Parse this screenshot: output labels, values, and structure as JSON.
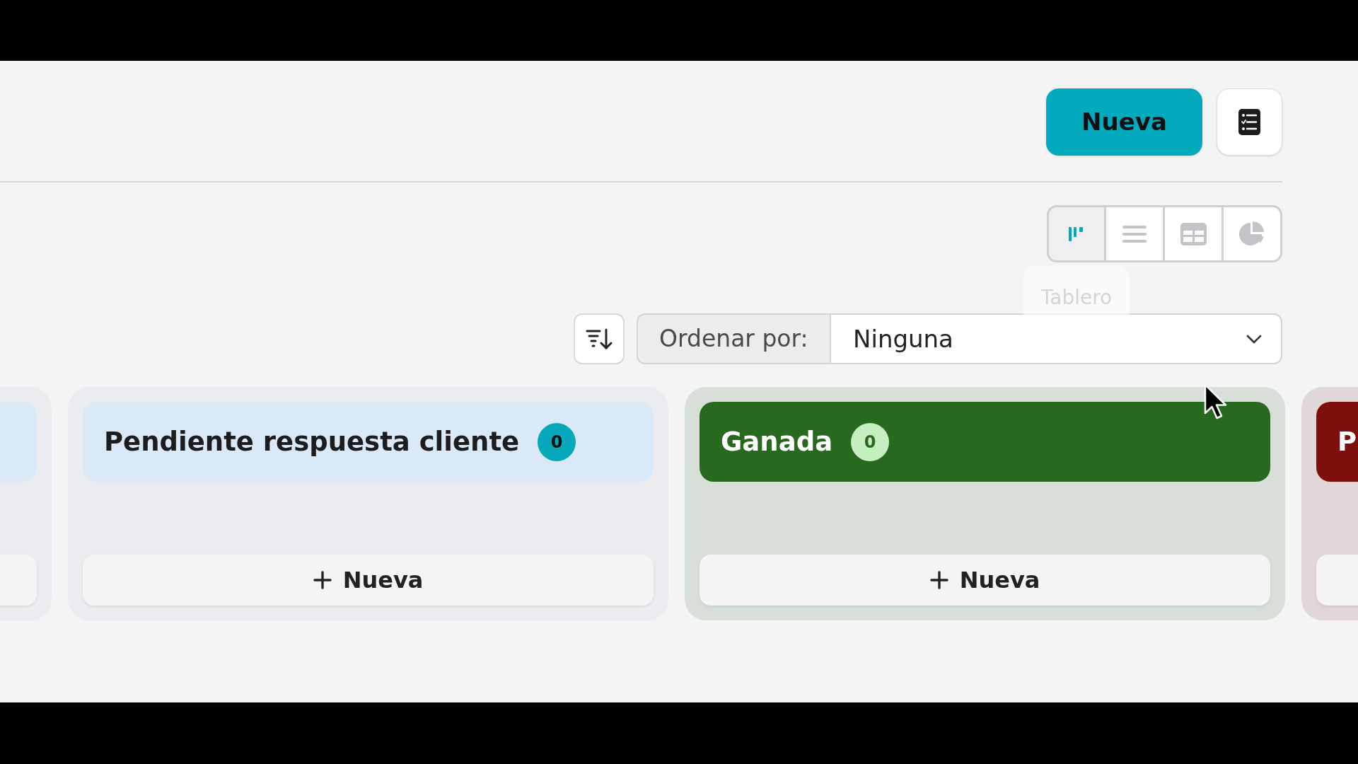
{
  "header": {
    "new_button": "Nueva"
  },
  "view_modes": [
    {
      "kind": "board",
      "selected": true
    },
    {
      "kind": "list",
      "selected": false
    },
    {
      "kind": "table",
      "selected": false
    },
    {
      "kind": "chart",
      "selected": false
    }
  ],
  "tooltip": "Tablero",
  "sort": {
    "label": "Ordenar por:",
    "value": "Ninguna"
  },
  "columns": [
    {
      "color": "#d9e9f7"
    },
    {
      "title": "Pendiente respuesta cliente",
      "badge": {
        "count": "0",
        "color": "#05a7ba"
      },
      "color": "#d9e9f7",
      "add_label": "Nueva"
    },
    {
      "title": "Ganada",
      "badge": {
        "count": "0",
        "color": "#c6efc1"
      },
      "color": "#27691e",
      "add_label": "Nueva"
    },
    {
      "title": "P",
      "color": "#7f0f0f"
    }
  ]
}
